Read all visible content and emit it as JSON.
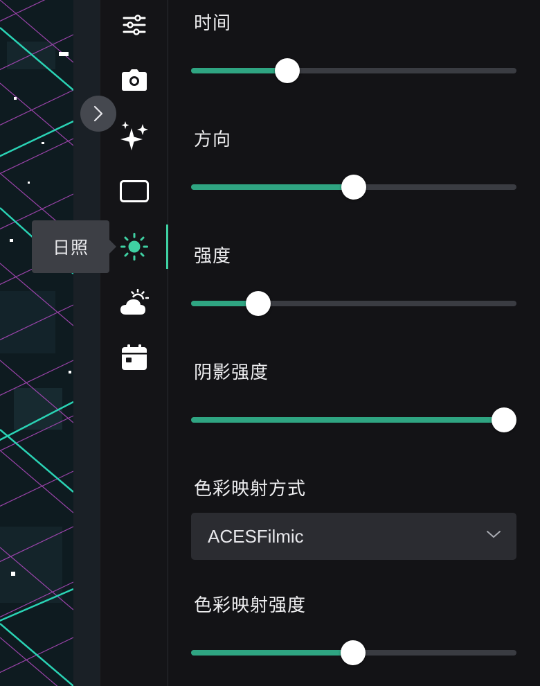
{
  "tooltip": {
    "label": "日照"
  },
  "rail": {
    "items": [
      {
        "name": "settings",
        "icon": "sliders-icon"
      },
      {
        "name": "camera",
        "icon": "camera-icon"
      },
      {
        "name": "effects",
        "icon": "sparkles-icon"
      },
      {
        "name": "frame",
        "icon": "rectangle-icon"
      },
      {
        "name": "sunlight",
        "icon": "sun-icon",
        "active": true
      },
      {
        "name": "weather",
        "icon": "partly-cloudy-icon"
      },
      {
        "name": "calendar",
        "icon": "calendar-icon"
      }
    ],
    "accent_color": "#3fd1a3"
  },
  "panel": {
    "fields": [
      {
        "label": "时间",
        "value": 0.295
      },
      {
        "label": "方向",
        "value": 0.5
      },
      {
        "label": "强度",
        "value": 0.207
      },
      {
        "label": "阴影强度",
        "value": 0.962
      },
      {
        "label": "色彩映射方式",
        "select": "ACESFilmic"
      },
      {
        "label": "色彩映射强度",
        "value": 0.498
      }
    ],
    "slider_fill_color": "#2fa582"
  }
}
